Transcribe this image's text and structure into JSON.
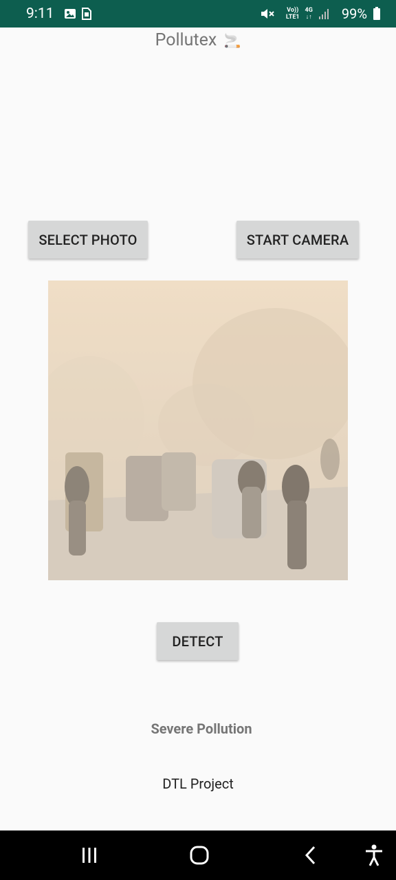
{
  "status_bar": {
    "time": "9:11",
    "volte_top": "Vo))",
    "volte_bottom": "LTE1",
    "network": "4G",
    "battery": "99%"
  },
  "app": {
    "title": "Pollutex",
    "title_emoji": "🚬"
  },
  "buttons": {
    "select_photo": "SELECT PHOTO",
    "start_camera": "START CAMERA",
    "detect": "DETECT"
  },
  "result": {
    "label": "Severe Pollution"
  },
  "footer": {
    "text": "DTL Project"
  },
  "icons": {
    "gallery": "image-icon",
    "sim": "sim-icon",
    "mute": "mute-icon",
    "signal": "signal-icon",
    "battery": "battery-icon",
    "recents": "recents-icon",
    "home": "home-icon",
    "back": "back-icon",
    "accessibility": "accessibility-icon"
  }
}
